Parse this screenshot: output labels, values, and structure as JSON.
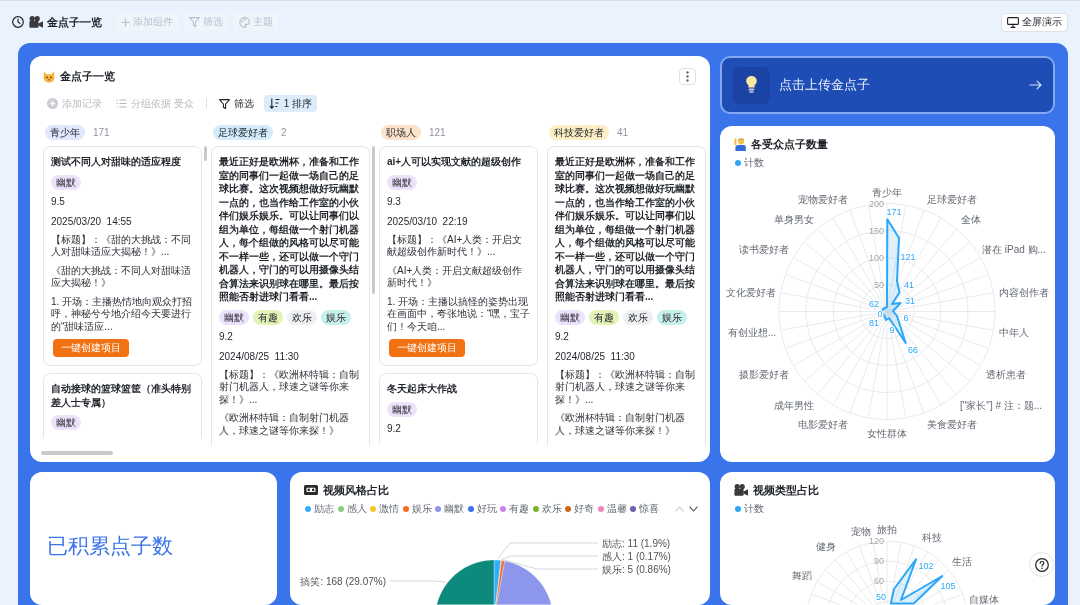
{
  "top_bar": {
    "title": "金点子一览",
    "buttons": [
      {
        "kind": "add",
        "label": "添加组件",
        "disabled": true
      },
      {
        "kind": "filter",
        "label": "筛选",
        "disabled": true
      },
      {
        "kind": "theme",
        "label": "主题",
        "disabled": true
      }
    ],
    "present_button": {
      "label": "全屏演示"
    }
  },
  "board": {
    "title": "金点子一览",
    "toolbar": [
      {
        "kind": "add",
        "label": "添加记录",
        "disabled": true,
        "active": false
      },
      {
        "kind": "group",
        "label": "分组依据 受众",
        "disabled": true,
        "active": false
      },
      {
        "kind": "filter",
        "label": "筛选",
        "disabled": false,
        "active": false
      },
      {
        "kind": "sort",
        "label": "1 排序",
        "disabled": false,
        "active": true
      }
    ],
    "columns": [
      {
        "label": "青少年",
        "count": "171",
        "color": "#e1e7fc",
        "cards": [
          {
            "title": "测试不同人对甜味的适应程度",
            "tags": [
              {
                "label": "幽默",
                "color": "#ece2fb"
              }
            ],
            "score": "9.5",
            "date": "2025/03/20  14:55",
            "fields": [
              "【标题】：《甜的大挑战：不同人对甜味适应大揭秘！》...",
              "《甜的大挑战：不同人对甜味适应大揭秘！》",
              "1. 开场：主播热情地向观众打招呼，神秘兮兮地介绍今天要进行的“甜味适应..."
            ],
            "button": "一键创建项目"
          },
          {
            "title": "自动接球的篮球篮筐（准头特别差人士专属）",
            "tags": [
              {
                "label": "幽默",
                "color": "#ece2fb"
              }
            ]
          }
        ]
      },
      {
        "label": "足球爱好者",
        "count": "2",
        "color": "#d3ebfa",
        "cards": [
          {
            "title": "最近正好是欧洲杯，准备和工作室的同事们一起做一场自己的足球比赛。这次视频想做好玩幽默一点的，也当作给工作室的小伙伴们娱乐娱乐。可以让同事们以组为单位，每组做一个射门机器人，每个组做的风格可以尽可能不一样一些，还可以做一个守门机器人，守门的可以用摄像头结合算法来识别球在哪里。最后按照能否射进球门看看...",
            "tags": [
              {
                "label": "幽默",
                "color": "#ece2fb"
              },
              {
                "label": "有趣",
                "color": "#e3f2b6"
              },
              {
                "label": "欢乐",
                "color": "#eeeff1"
              },
              {
                "label": "娱乐",
                "color": "#c6f0e9"
              }
            ],
            "score": "9.2",
            "date": "2024/08/25  11:30",
            "fields": [
              "【标题】：《欧洲杯特辑：自制射门机器人，球速之谜等你来探！》...",
              "《欧洲杯特辑：自制射门机器人，球速之谜等你来探！》"
            ]
          }
        ]
      },
      {
        "label": "职场人",
        "count": "121",
        "color": "#fde2cb",
        "cards": [
          {
            "title": "ai+人可以实现文献的超级创作",
            "tags": [
              {
                "label": "幽默",
                "color": "#ece2fb"
              }
            ],
            "score": "9.3",
            "date": "2025/03/10  22:19",
            "fields": [
              "【标题】：《AI+人类：开启文献超级创作新时代！》...",
              "《AI+人类：开启文献超级创作新时代！》",
              "1. 开场：主播以搞怪的姿势出现在画面中，夸张地说：“嘿，宝子们！今天咱..."
            ],
            "button": "一键创建项目"
          },
          {
            "title": "冬天起床大作战",
            "tags": [
              {
                "label": "幽默",
                "color": "#ece2fb"
              }
            ],
            "score": "9.2"
          }
        ]
      },
      {
        "label": "科技爱好者",
        "count": "41",
        "color": "#fcefc5",
        "cards": [
          {
            "title": "最近正好是欧洲杯，准备和工作室的同事们一起做一场自己的足球比赛。这次视频想做好玩幽默一点的，也当作给工作室的小伙伴们娱乐娱乐。可以让同事们以组为单位，每组做一个射门机器人，每个组做的风格可以尽可能不一样一些，还可以做一个守门机器人，守门的可以用摄像头结合算法来识别球在哪里。最后按照能否射进球门看看...",
            "tags": [
              {
                "label": "幽默",
                "color": "#ece2fb"
              },
              {
                "label": "有趣",
                "color": "#e3f2b6"
              },
              {
                "label": "欢乐",
                "color": "#eeeff1"
              },
              {
                "label": "娱乐",
                "color": "#c6f0e9"
              }
            ],
            "score": "9.2",
            "date": "2024/08/25  11:30",
            "fields": [
              "【标题】：《欧洲杯特辑：自制射门机器人，球速之谜等你来探！》...",
              "《欧洲杯特辑：自制射门机器人，球速之谜等你来探！》"
            ]
          }
        ]
      }
    ]
  },
  "upload_button": {
    "label": "点击上传金点子"
  },
  "audience_chart": {
    "title": "各受众点子数量",
    "legend": [
      {
        "label": "计数",
        "color": "#2ea7f7"
      }
    ],
    "ticks": [
      "200",
      "150",
      "100",
      "50"
    ],
    "axis_labels": [
      "青少年",
      "宠物爱好者",
      "足球爱好者",
      "单身男女",
      "全体",
      "读书爱好者",
      "潜在 iPad 购...",
      "文化爱好者",
      "内容创作者",
      "有创业想...",
      "中年人",
      "摄影爱好者",
      "透析患者",
      "成年男性",
      "[\"家长\"] # 注：题...",
      "电影爱好者",
      "美食爱好者",
      "女性群体"
    ],
    "data_labels": [
      "171",
      "121",
      "41",
      "31",
      "62",
      "0",
      "6",
      "81",
      "9",
      "66"
    ]
  },
  "idea_total": {
    "label": "已积累点子数"
  },
  "style_chart": {
    "title": "视频风格占比",
    "legend": [
      {
        "label": "励志",
        "color": "#34aefc"
      },
      {
        "label": "感人",
        "color": "#86d07e"
      },
      {
        "label": "激情",
        "color": "#fbc22f"
      },
      {
        "label": "娱乐",
        "color": "#f76a26"
      },
      {
        "label": "幽默",
        "color": "#8b96ec"
      },
      {
        "label": "好玩",
        "color": "#3f6ff0"
      },
      {
        "label": "有趣",
        "color": "#c981f2"
      },
      {
        "label": "欢乐",
        "color": "#79b42a"
      },
      {
        "label": "好奇",
        "color": "#c8681a"
      },
      {
        "label": "温馨",
        "color": "#f384b8"
      },
      {
        "label": "惊喜",
        "color": "#6e5fb1"
      }
    ],
    "legend_pager": {
      "prev_disabled": true,
      "next_disabled": false
    },
    "slice_labels": [
      "励志: 11 (1.9%)",
      "感人: 1 (0.17%)",
      "娱乐: 5 (0.86%)",
      "搞笑: 168 (29.07%)"
    ]
  },
  "type_chart": {
    "title": "视频类型占比",
    "legend": [
      {
        "label": "计数",
        "color": "#2ea7f7"
      }
    ],
    "ticks": [
      "120",
      "90",
      "60"
    ],
    "axis_labels": [
      "旅拍",
      "宠物",
      "科技",
      "健身",
      "生活",
      "舞蹈",
      "自媒体"
    ],
    "data_labels": [
      "102",
      "105",
      "50"
    ]
  }
}
